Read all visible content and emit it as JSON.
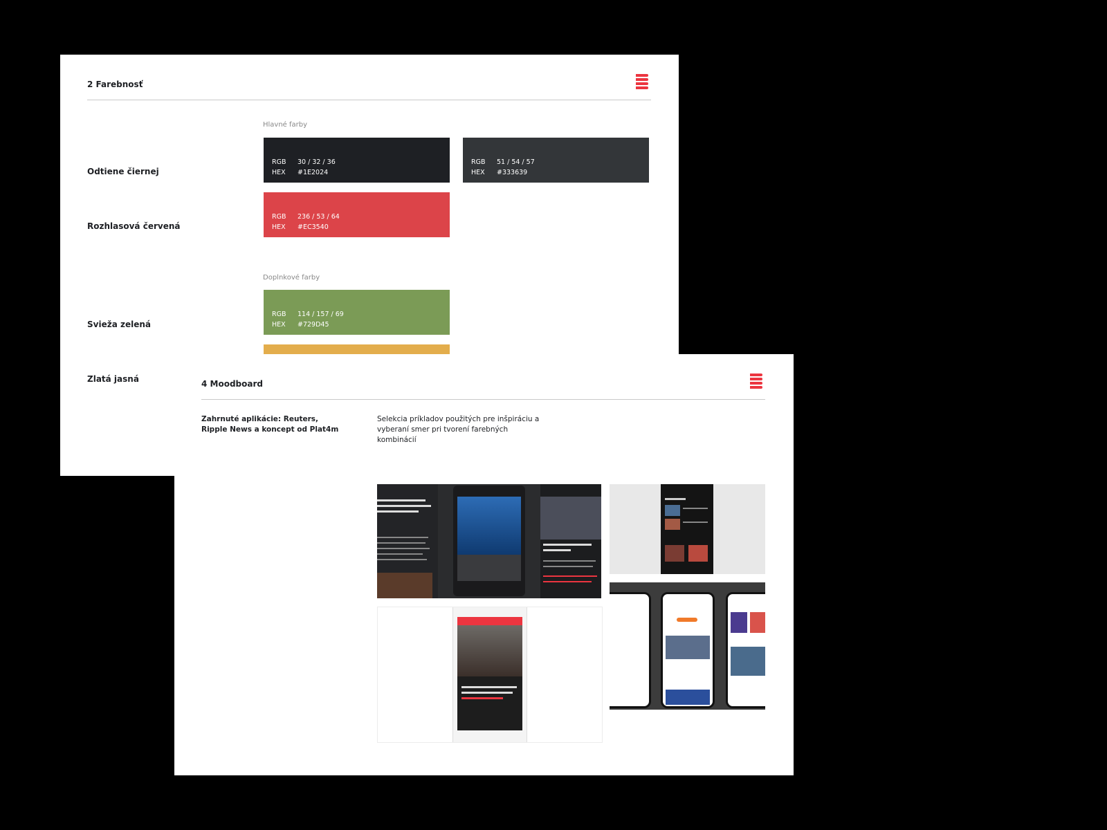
{
  "farebnost": {
    "title": "2 Farebnosť",
    "main_section": "Hlavné farby",
    "extra_section": "Doplnkové farby",
    "rows": [
      {
        "label": "Odtiene čiernej"
      },
      {
        "label": "Rozhlasová červená"
      },
      {
        "label": "Svieža zelená"
      },
      {
        "label": "Zlatá jasná"
      }
    ],
    "swatches": [
      {
        "rgb_key": "RGB",
        "rgb": "30 / 32 / 36",
        "hex_key": "HEX",
        "hex": "#1E2024",
        "color": "#1e2024"
      },
      {
        "rgb_key": "RGB",
        "rgb": "51 / 54 / 57",
        "hex_key": "HEX",
        "hex": "#333639",
        "color": "#333639"
      },
      {
        "rgb_key": "RGB",
        "rgb": "236 / 53 / 64",
        "hex_key": "HEX",
        "hex": "#EC3540",
        "color": "#dc4449"
      },
      {
        "rgb_key": "RGB",
        "rgb": "114 / 157 / 69",
        "hex_key": "HEX",
        "hex": "#729D45",
        "color": "#7b9b56"
      },
      {
        "color": "#e3ad4c"
      }
    ]
  },
  "moodboard": {
    "title": "4 Moodboard",
    "apps_text": "Zahrnuté aplikácie: Reuters, Ripple News a koncept od Plat4m",
    "selection_text": "Selekcia príkladov použitých pre inšpiráciu a vyberaní smer pri tvorení farebných kombinácií",
    "brand_color": "#ec3540"
  }
}
